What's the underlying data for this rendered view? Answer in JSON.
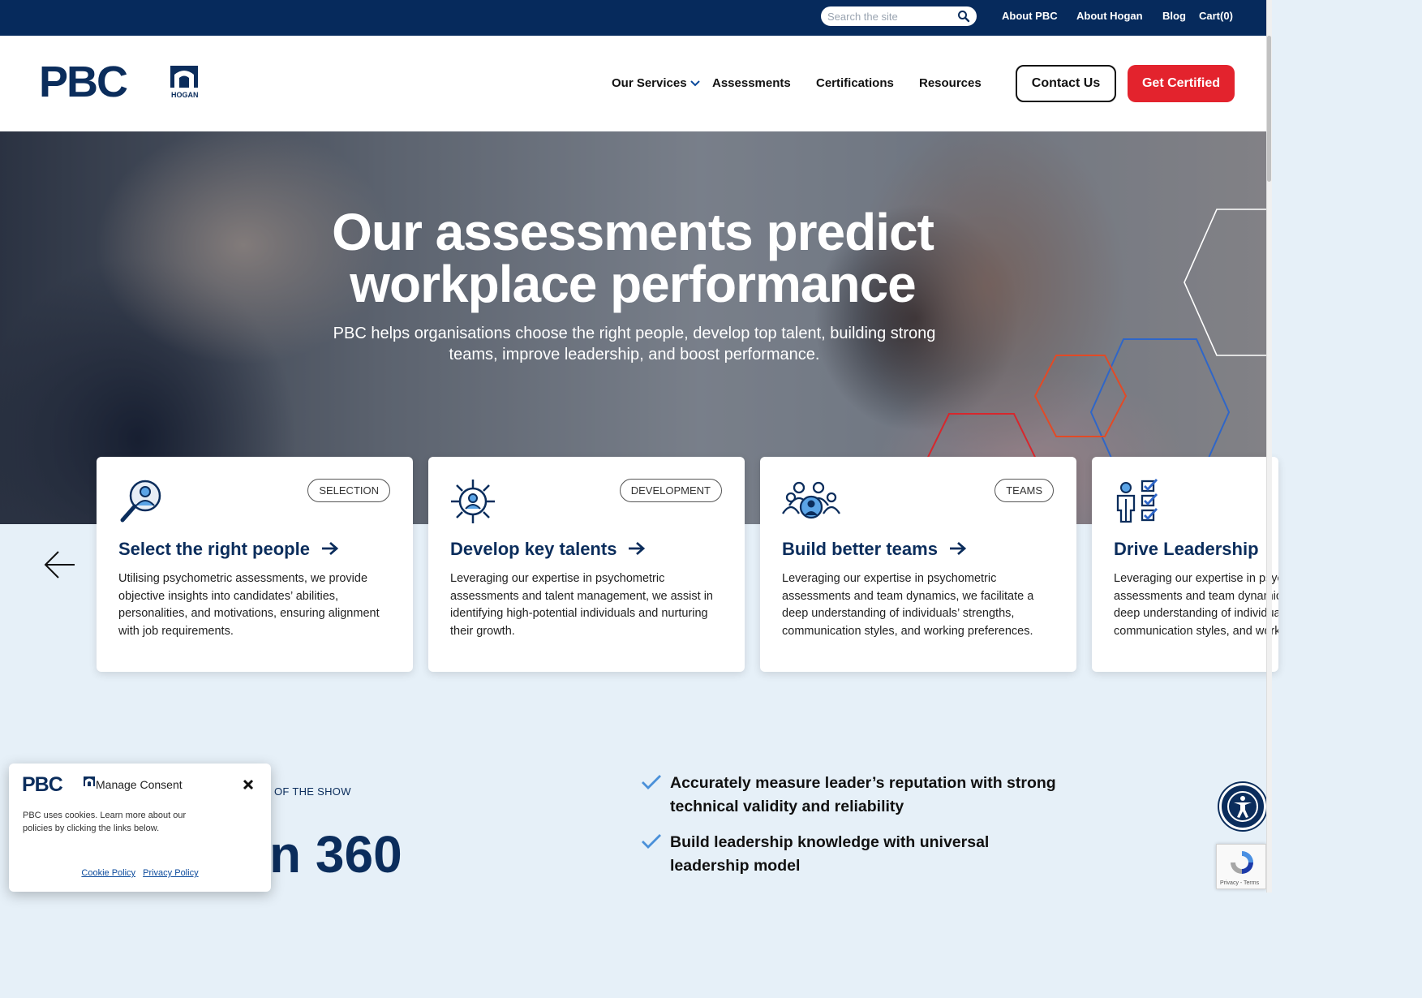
{
  "topbar": {
    "search_placeholder": "Search the site",
    "links": [
      "About PBC",
      "About Hogan",
      "Blog",
      "Cart(0)"
    ]
  },
  "header": {
    "logo_text": "PBC",
    "logo_sub": "HOGAN",
    "nav": [
      "Our Services",
      "Assessments",
      "Certifications",
      "Resources"
    ],
    "contact_label": "Contact Us",
    "cert_label": "Get Certified"
  },
  "hero": {
    "title_line1": "Our assessments predict",
    "title_line2": "workplace performance",
    "subtitle": "PBC helps organisations choose the right people, develop top talent, building strong teams, improve leadership, and boost performance."
  },
  "cards": [
    {
      "tag": "SELECTION",
      "title": "Select the right people",
      "text": "Utilising psychometric assessments, we provide objective insights into candidates’ abilities, personalities, and motivations, ensuring alignment with job requirements.",
      "icon": "search-person-icon"
    },
    {
      "tag": "DEVELOPMENT",
      "title": "Develop key talents",
      "text": "Leveraging our expertise in psychometric assessments and talent management, we assist in identifying high-potential individuals and nurturing their growth.",
      "icon": "growth-compass-icon"
    },
    {
      "tag": "TEAMS",
      "title": "Build better teams",
      "text": "Leveraging our expertise in psychometric assessments and team dynamics, we facilitate a deep understanding of individuals’ strengths, communication styles, and working preferences.",
      "icon": "team-icon"
    },
    {
      "tag": "",
      "title": "Drive Leadership",
      "text": "Leveraging our expertise in psychometric assessments and team dynamics, we facilitate a deep understanding of individuals’ strengths, communication styles, and working preferences.",
      "icon": "leader-checklist-icon"
    }
  ],
  "section": {
    "eyebrow": "OF THE SHOW",
    "title": "n 360",
    "bullets": [
      "Accurately measure leader’s reputation with strong technical validity and reliability",
      "Build leadership knowledge with universal leadership model"
    ]
  },
  "consent": {
    "logo_text": "PBC",
    "title": "Manage Consent",
    "text": "PBC uses cookies. Learn more about our policies by clicking the links below.",
    "cookie_link": "Cookie Policy",
    "privacy_link": "Privacy Policy"
  },
  "recaptcha": {
    "text": "Privacy - Terms"
  },
  "colors": {
    "navy": "#062a5c",
    "brand_blue": "#0b2d5c",
    "red": "#e3232d",
    "bg_light": "#e6f0f8"
  }
}
